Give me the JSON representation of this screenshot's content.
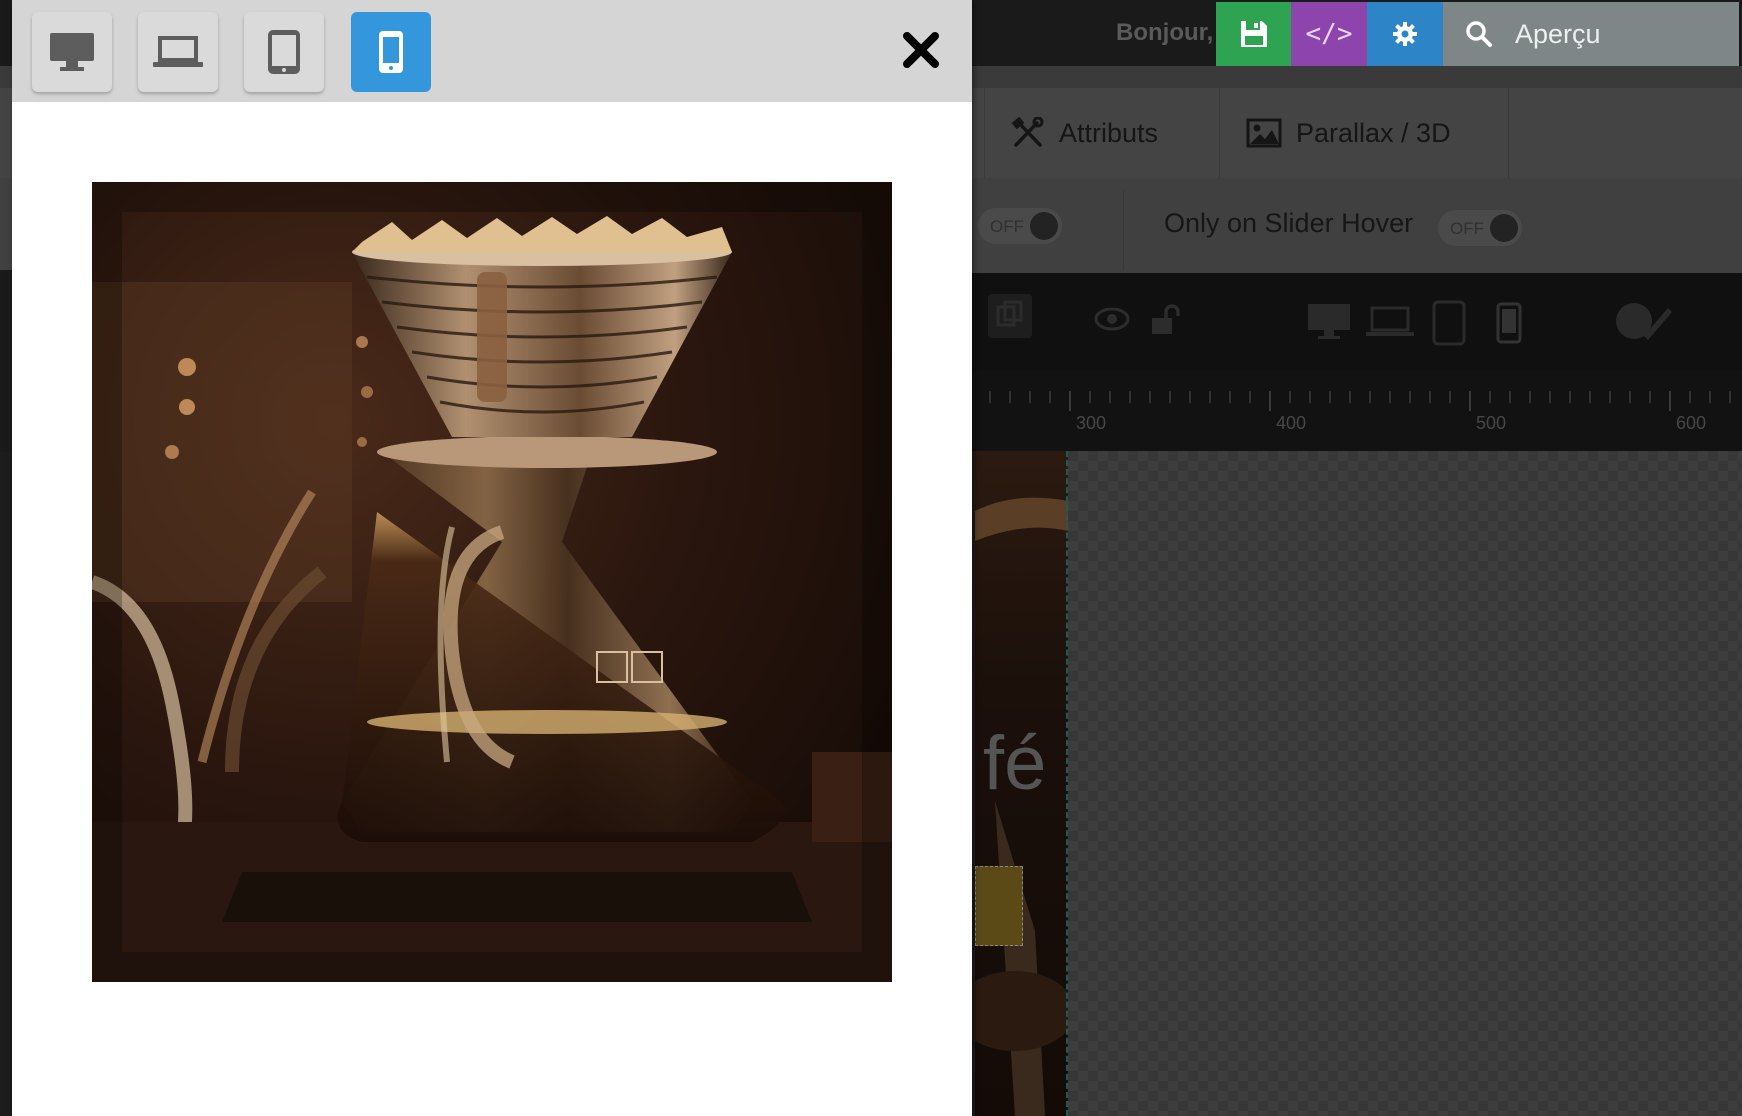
{
  "admin_bar": {
    "greeting": "Bonjour,",
    "save_icon": "floppy-disk-icon",
    "code_label": "</>",
    "settings_icon": "gear-icon",
    "preview_label": "Aperçu",
    "colors": {
      "save": "#2ea352",
      "code": "#8e44ad",
      "settings": "#2d84c7",
      "preview": "#7e8687"
    }
  },
  "tabs": [
    {
      "label": "Attributs",
      "icon": "tools-icon"
    },
    {
      "label": "Parallax / 3D",
      "icon": "image-icon"
    }
  ],
  "options": {
    "toggle_a": "OFF",
    "hover_label": "Only on Slider Hover",
    "toggle_b": "OFF"
  },
  "ruler": {
    "labels": [
      "300",
      "400",
      "500",
      "600"
    ]
  },
  "slide": {
    "text": "fé ?"
  },
  "modal": {
    "devices": [
      {
        "name": "desktop",
        "active": false
      },
      {
        "name": "laptop",
        "active": false
      },
      {
        "name": "tablet",
        "active": false
      },
      {
        "name": "mobile",
        "active": true
      }
    ],
    "accent": "#3497dc",
    "preview_image": "coffee-pour-over-dripper-photo"
  }
}
